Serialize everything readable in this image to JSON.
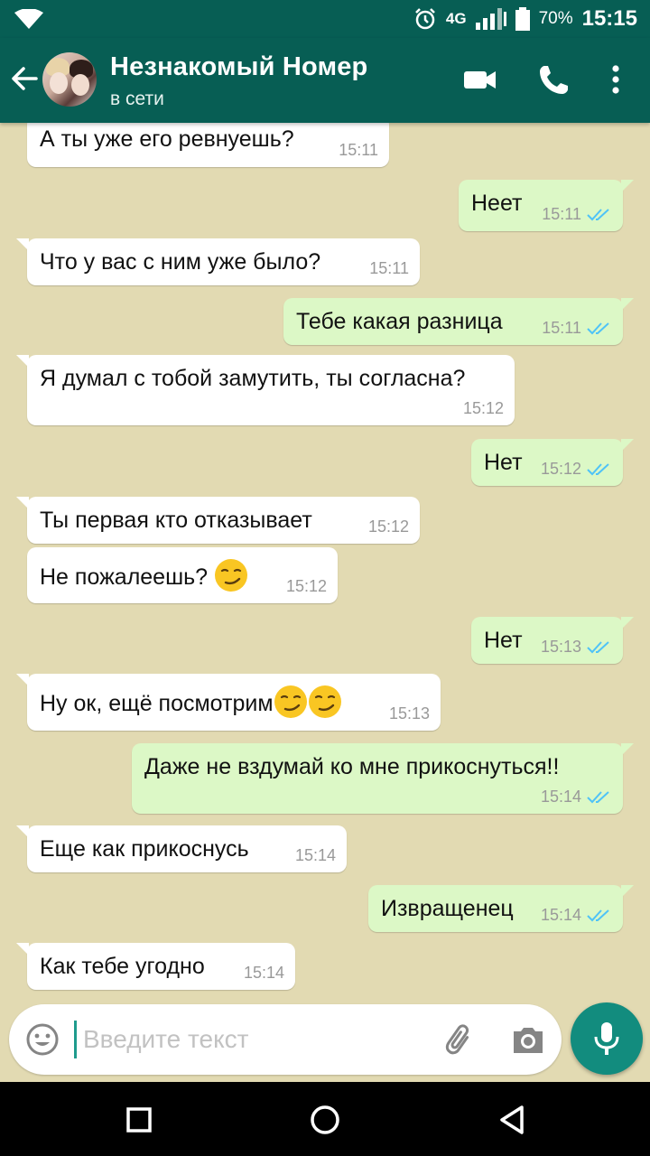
{
  "status_bar": {
    "network": "4G",
    "battery": "70%",
    "time": "15:15"
  },
  "header": {
    "contact_name": "Незнакомый Номер",
    "contact_status": "в сети",
    "icons": [
      "back-arrow-icon",
      "video-call-icon",
      "phone-call-icon",
      "more-vert-icon"
    ]
  },
  "messages": [
    {
      "dir": "in",
      "text": "А ты уже его ревнуешь?",
      "time": "15:11"
    },
    {
      "dir": "out",
      "text": "Неет",
      "time": "15:11",
      "read": true
    },
    {
      "dir": "in",
      "text": "Что у вас с ним уже было?",
      "time": "15:11"
    },
    {
      "dir": "out",
      "text": "Тебе какая разница",
      "time": "15:11",
      "read": true
    },
    {
      "dir": "in",
      "text": "Я думал с тобой замутить, ты согласна?",
      "time": "15:12"
    },
    {
      "dir": "out",
      "text": "Нет",
      "time": "15:12",
      "read": true
    },
    {
      "dir": "in",
      "text": "Ты первая кто отказывает",
      "time": "15:12"
    },
    {
      "dir": "in",
      "text": "Не пожалеешь?",
      "emoji": [
        "smirk"
      ],
      "time": "15:12"
    },
    {
      "dir": "out",
      "text": "Нет",
      "time": "15:13",
      "read": true
    },
    {
      "dir": "in",
      "text": "Ну ок, ещё посмотрим",
      "emoji": [
        "smirk",
        "smirk"
      ],
      "time": "15:13"
    },
    {
      "dir": "out",
      "text": "Даже не вздумай ко мне прикоснуться!!",
      "time": "15:14",
      "read": true
    },
    {
      "dir": "in",
      "text": "Еще как прикоснусь",
      "time": "15:14"
    },
    {
      "dir": "out",
      "text": "Извращенец",
      "time": "15:14",
      "read": true
    },
    {
      "dir": "in",
      "text": "Как тебе угодно",
      "time": "15:14"
    }
  ],
  "composer": {
    "placeholder": "Введите текст",
    "value": ""
  },
  "colors": {
    "header": "#075e54",
    "chat_background": "#e2dab2",
    "incoming_bubble": "#ffffff",
    "outgoing_bubble": "#dcf8c6",
    "read_ticks": "#4fc3f7",
    "mic_button": "#128c7e"
  }
}
